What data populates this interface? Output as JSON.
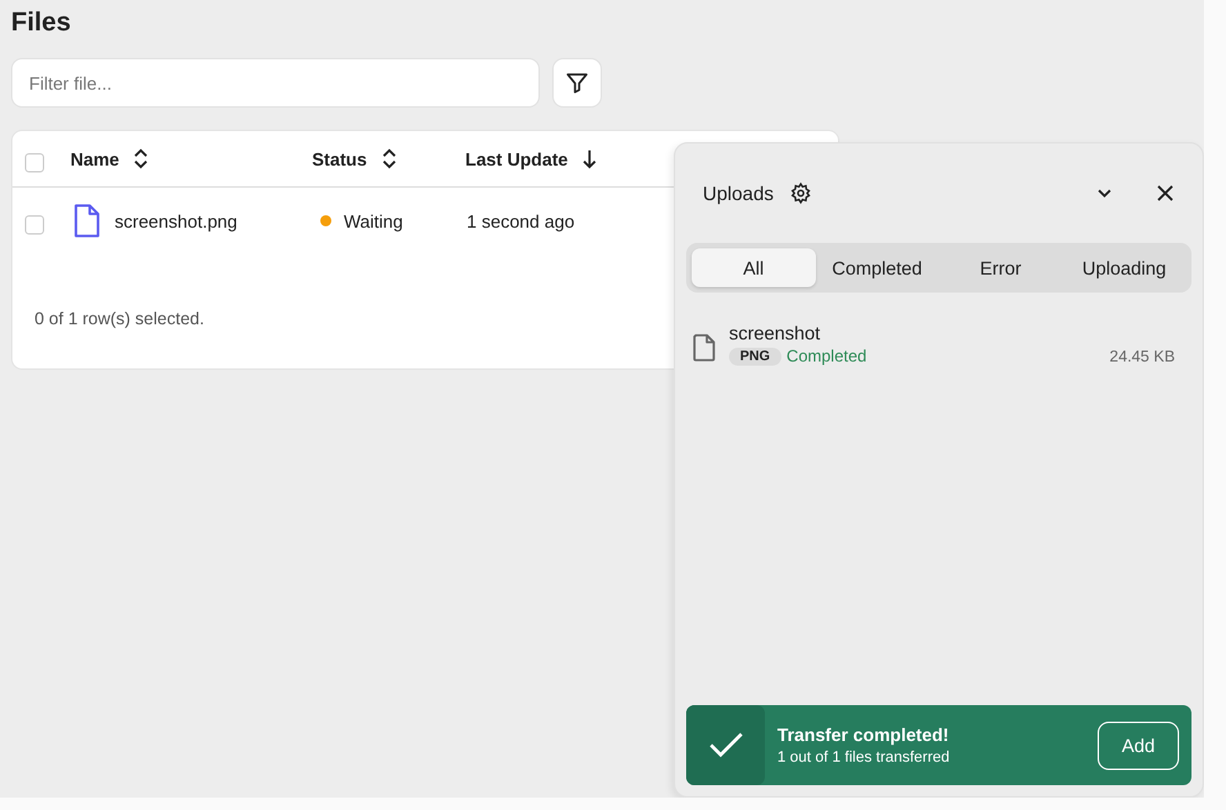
{
  "title": "Files",
  "filter": {
    "placeholder": "Filter file..."
  },
  "table": {
    "select_all": {
      "checked": false
    },
    "columns": [
      {
        "label": "Name",
        "kind": "sortable"
      },
      {
        "label": "Status",
        "kind": "sortable"
      },
      {
        "label": "Last Update",
        "kind": "descending"
      }
    ],
    "rows": [
      {
        "checked": false,
        "name": "screenshot.png",
        "status": "Waiting",
        "color": "#f59e0b",
        "updated": "1 second ago"
      }
    ],
    "footer": "0 of 1 row(s) selected."
  },
  "uploads": {
    "title": "Uploads",
    "tabs": [
      {
        "label": "All",
        "selected": true
      },
      {
        "label": "Completed",
        "selected": false
      },
      {
        "label": "Error",
        "selected": false
      },
      {
        "label": "Uploading",
        "selected": false
      }
    ],
    "files": [
      {
        "name": "screenshot",
        "type": "PNG",
        "status": "Completed",
        "size": "24.45 KB"
      }
    ],
    "toast": {
      "title": "Transfer completed!",
      "message": "1 out of 1 files transferred",
      "button": "Add"
    }
  }
}
